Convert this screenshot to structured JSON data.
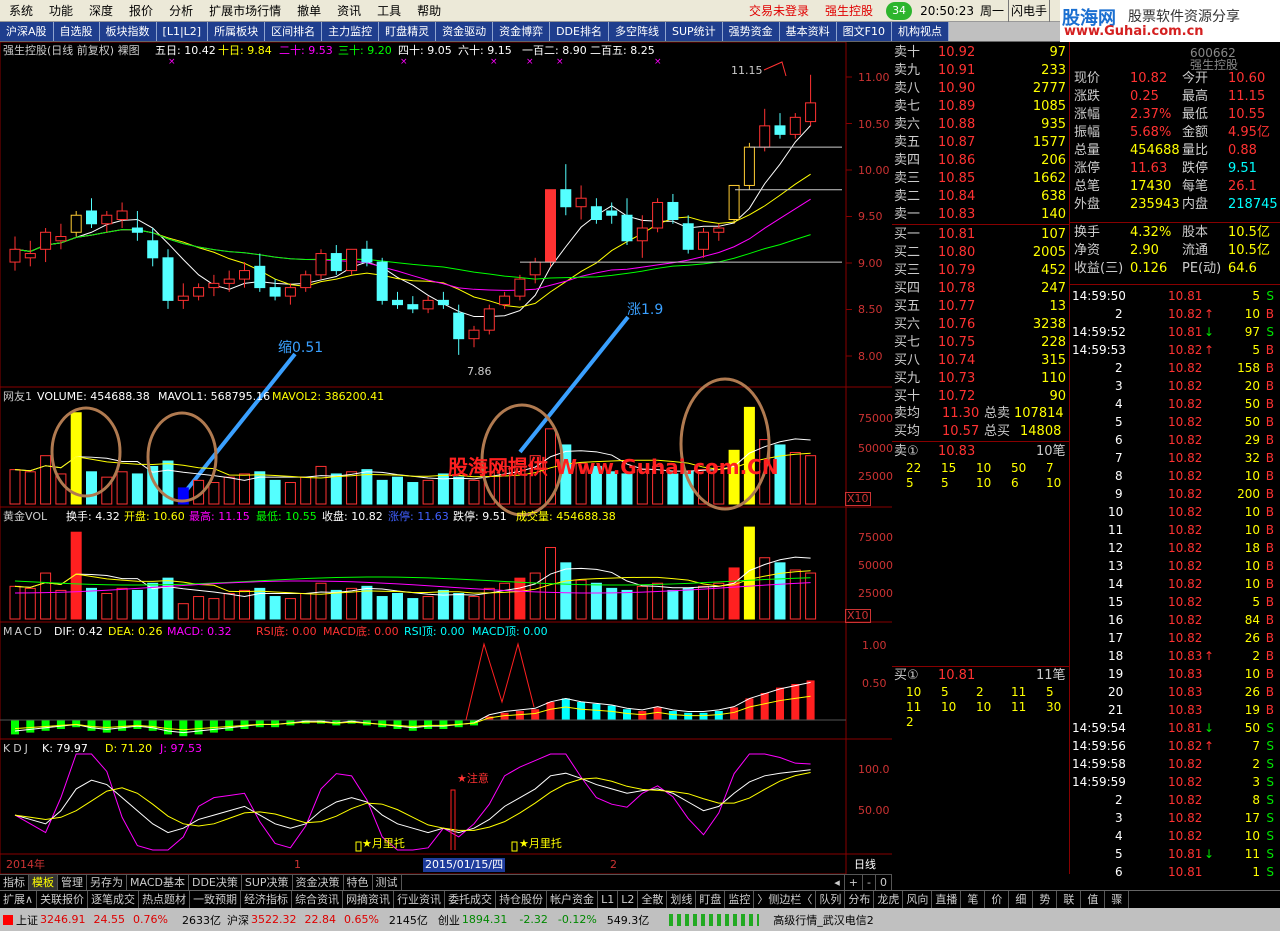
{
  "menubar": {
    "items": [
      "系统",
      "功能",
      "深度",
      "报价",
      "分析",
      "扩展市场行情",
      "撤单",
      "资讯",
      "工具",
      "帮助"
    ],
    "trade_status": "交易未登录",
    "stock_name": "强生控股",
    "badge": "34",
    "time": "20:50:23",
    "weekday": "周一",
    "flash": "闪电手"
  },
  "toolbar": {
    "items": [
      "沪深A股",
      "自选股",
      "板块指数",
      "[L1|L2]",
      "所属板块",
      "区间排名",
      "主力监控",
      "盯盘精灵",
      "资金驱动",
      "资金博弈",
      "DDE排名",
      "多空阵线",
      "SUP统计",
      "强势资金",
      "基本资料",
      "图文F10",
      "机构视点"
    ]
  },
  "logo": {
    "site": "股海网",
    "slogan": "股票软件资源分享",
    "url": "www.Guhai.com.cn"
  },
  "chart_header": {
    "title": "强生控股(日线 前复权) 裸图",
    "ma5": "五日: 10.42",
    "ma10": "十日: 9.84",
    "ma20": "二十: 9.53",
    "ma30": "三十: 9.20",
    "ma40": "四十: 9.05",
    "ma60": "六十: 9.15",
    "ma120": "一百二: 8.90",
    "ma250": "二百五: 8.25"
  },
  "price_axis": [
    "11.00",
    "10.50",
    "10.00",
    "9.50",
    "9.00",
    "8.50",
    "8.00"
  ],
  "annotations": {
    "shrink": "缩0.51",
    "rise": "涨1.9",
    "high_label": "11.15",
    "low_label": "7.86",
    "notice": "★注意",
    "moon1": "★月里托",
    "moon2": "★月里托",
    "watermark": "股海网提供 Www.Guhai.com.CN"
  },
  "vol_header": {
    "name": "网友1",
    "volume": "VOLUME: 454688.38",
    "mavol1": "MAVOL1: 568795.16",
    "mavol2": "MAVOL2: 386200.41"
  },
  "vol_axis": [
    "75000",
    "50000",
    "25000"
  ],
  "vol_multiplier": "X10",
  "vol2_header": {
    "name": "黄金VOL",
    "turnover": "换手: 4.32",
    "open": "开盘: 10.60",
    "high": "最高: 11.15",
    "low": "最低: 10.55",
    "close": "收盘: 10.82",
    "limitup": "涨停: 11.63",
    "limitdown": "跌停: 9.51",
    "volume": "成交量: 454688.38"
  },
  "vol2_axis": [
    "75000",
    "50000",
    "25000"
  ],
  "macd_header": {
    "name": "MACD",
    "dif": "DIF: 0.42",
    "dea": "DEA: 0.26",
    "macd": "MACD: 0.32",
    "rsibottom": "RSI底: 0.00",
    "macdbottom": "MACD底: 0.00",
    "rsitop": "RSI顶: 0.00",
    "macdtop": "MACD顶: 0.00"
  },
  "macd_axis": [
    "1.00",
    "0.50"
  ],
  "kdj_header": {
    "name": "KDJ",
    "k": "K: 79.97",
    "d": "D: 71.20",
    "j": "J: 97.53"
  },
  "kdj_axis": [
    "100.0",
    "50.00"
  ],
  "time_axis": {
    "year": "2014年",
    "m1": "1",
    "selected_date": "2015/01/15/四",
    "m2": "2",
    "period": "日线"
  },
  "chart_data": {
    "type": "candlestick",
    "ohlc": [
      [
        8.95,
        9.25,
        8.85,
        9.1
      ],
      [
        9.0,
        9.2,
        8.9,
        9.05
      ],
      [
        9.1,
        9.35,
        8.95,
        9.3
      ],
      [
        9.2,
        9.4,
        9.1,
        9.25
      ],
      [
        9.3,
        9.55,
        9.25,
        9.5
      ],
      [
        9.55,
        9.7,
        9.35,
        9.4
      ],
      [
        9.4,
        9.55,
        9.3,
        9.5
      ],
      [
        9.45,
        9.65,
        9.35,
        9.55
      ],
      [
        9.35,
        9.55,
        9.2,
        9.3
      ],
      [
        9.2,
        9.35,
        8.9,
        9.0
      ],
      [
        9.0,
        9.1,
        8.4,
        8.5
      ],
      [
        8.5,
        8.7,
        8.4,
        8.55
      ],
      [
        8.55,
        8.7,
        8.5,
        8.65
      ],
      [
        8.65,
        8.8,
        8.55,
        8.7
      ],
      [
        8.7,
        8.85,
        8.6,
        8.75
      ],
      [
        8.75,
        8.95,
        8.65,
        8.85
      ],
      [
        8.9,
        9.05,
        8.6,
        8.65
      ],
      [
        8.65,
        8.75,
        8.5,
        8.55
      ],
      [
        8.55,
        8.7,
        8.45,
        8.65
      ],
      [
        8.65,
        8.85,
        8.6,
        8.8
      ],
      [
        8.8,
        9.1,
        8.75,
        9.05
      ],
      [
        9.05,
        9.15,
        8.8,
        8.85
      ],
      [
        8.85,
        9.1,
        8.8,
        9.1
      ],
      [
        9.1,
        9.2,
        8.9,
        8.95
      ],
      [
        8.95,
        9.0,
        8.45,
        8.5
      ],
      [
        8.5,
        8.6,
        8.4,
        8.45
      ],
      [
        8.45,
        8.55,
        8.35,
        8.4
      ],
      [
        8.4,
        8.55,
        8.35,
        8.5
      ],
      [
        8.5,
        8.6,
        8.4,
        8.45
      ],
      [
        8.35,
        8.45,
        7.86,
        8.05
      ],
      [
        8.05,
        8.2,
        7.95,
        8.15
      ],
      [
        8.15,
        8.45,
        8.1,
        8.4
      ],
      [
        8.45,
        8.6,
        8.4,
        8.55
      ],
      [
        8.55,
        8.8,
        8.5,
        8.75
      ],
      [
        8.8,
        9.0,
        8.7,
        8.95
      ],
      [
        8.95,
        9.8,
        8.9,
        9.8
      ],
      [
        9.8,
        10.1,
        9.5,
        9.6
      ],
      [
        9.6,
        9.85,
        9.45,
        9.7
      ],
      [
        9.6,
        9.7,
        9.4,
        9.45
      ],
      [
        9.55,
        9.65,
        9.4,
        9.5
      ],
      [
        9.5,
        9.7,
        9.15,
        9.2
      ],
      [
        9.2,
        9.5,
        9.0,
        9.35
      ],
      [
        9.35,
        9.7,
        9.3,
        9.65
      ],
      [
        9.65,
        9.75,
        9.4,
        9.45
      ],
      [
        9.4,
        9.5,
        9.05,
        9.1
      ],
      [
        9.1,
        9.35,
        9.0,
        9.3
      ],
      [
        9.3,
        9.4,
        9.2,
        9.35
      ],
      [
        9.45,
        9.85,
        9.4,
        9.85
      ],
      [
        9.85,
        10.35,
        9.8,
        10.3
      ],
      [
        10.3,
        10.75,
        10.25,
        10.55
      ],
      [
        10.55,
        10.7,
        10.4,
        10.45
      ],
      [
        10.45,
        10.7,
        10.4,
        10.65
      ],
      [
        10.6,
        11.15,
        10.55,
        10.82
      ]
    ],
    "volume": [
      32,
      30,
      45,
      28,
      85,
      30,
      25,
      30,
      28,
      35,
      40,
      15,
      22,
      20,
      25,
      28,
      30,
      22,
      20,
      25,
      35,
      28,
      30,
      32,
      22,
      25,
      20,
      22,
      28,
      25,
      22,
      30,
      35,
      40,
      45,
      70,
      55,
      38,
      35,
      30,
      28,
      32,
      35,
      28,
      30,
      32,
      35,
      50,
      90,
      60,
      55,
      48,
      45
    ],
    "macd_hist": [
      -0.08,
      -0.07,
      -0.06,
      -0.05,
      -0.04,
      -0.06,
      -0.07,
      -0.06,
      -0.05,
      -0.06,
      -0.08,
      -0.09,
      -0.08,
      -0.07,
      -0.06,
      -0.05,
      -0.04,
      -0.04,
      -0.03,
      -0.02,
      -0.02,
      -0.03,
      -0.02,
      -0.03,
      -0.04,
      -0.05,
      -0.06,
      -0.05,
      -0.05,
      -0.04,
      -0.03,
      0.02,
      0.04,
      0.05,
      0.06,
      0.1,
      0.12,
      0.1,
      0.09,
      0.08,
      0.06,
      0.05,
      0.07,
      0.05,
      0.04,
      0.04,
      0.05,
      0.07,
      0.12,
      0.15,
      0.18,
      0.2,
      0.22
    ],
    "kdj_k": [
      40,
      35,
      30,
      45,
      70,
      80,
      75,
      60,
      45,
      30,
      20,
      25,
      35,
      40,
      45,
      50,
      40,
      30,
      25,
      30,
      45,
      55,
      60,
      55,
      40,
      30,
      25,
      20,
      25,
      20,
      25,
      35,
      50,
      60,
      70,
      85,
      88,
      82,
      75,
      70,
      65,
      68,
      70,
      65,
      55,
      45,
      50,
      65,
      78,
      85,
      88,
      90,
      92
    ]
  },
  "quote": {
    "code": "600662",
    "name": "强生控股",
    "sell_levels": [
      {
        "label": "卖十",
        "price": "10.92",
        "vol": "97"
      },
      {
        "label": "卖九",
        "price": "10.91",
        "vol": "233"
      },
      {
        "label": "卖八",
        "price": "10.90",
        "vol": "2777"
      },
      {
        "label": "卖七",
        "price": "10.89",
        "vol": "1085"
      },
      {
        "label": "卖六",
        "price": "10.88",
        "vol": "935"
      },
      {
        "label": "卖五",
        "price": "10.87",
        "vol": "1577"
      },
      {
        "label": "卖四",
        "price": "10.86",
        "vol": "206"
      },
      {
        "label": "卖三",
        "price": "10.85",
        "vol": "1662"
      },
      {
        "label": "卖二",
        "price": "10.84",
        "vol": "638"
      },
      {
        "label": "卖一",
        "price": "10.83",
        "vol": "140"
      }
    ],
    "buy_levels": [
      {
        "label": "买一",
        "price": "10.81",
        "vol": "107"
      },
      {
        "label": "买二",
        "price": "10.80",
        "vol": "2005"
      },
      {
        "label": "买三",
        "price": "10.79",
        "vol": "452"
      },
      {
        "label": "买四",
        "price": "10.78",
        "vol": "247"
      },
      {
        "label": "买五",
        "price": "10.77",
        "vol": "13"
      },
      {
        "label": "买六",
        "price": "10.76",
        "vol": "3238"
      },
      {
        "label": "买七",
        "price": "10.75",
        "vol": "228"
      },
      {
        "label": "买八",
        "price": "10.74",
        "vol": "315"
      },
      {
        "label": "买九",
        "price": "10.73",
        "vol": "110"
      },
      {
        "label": "买十",
        "price": "10.72",
        "vol": "90"
      }
    ],
    "avg_sell_label": "卖均",
    "avg_sell": "11.30",
    "total_sell_label": "总卖",
    "total_sell": "107814",
    "avg_buy_label": "买均",
    "avg_buy": "10.57",
    "total_buy_label": "总买",
    "total_buy": "14808",
    "sell1_queue_label": "卖①",
    "sell1_queue_price": "10.83",
    "sell1_queue_count": "10笔",
    "sell1_queue": [
      "22",
      "15",
      "10",
      "50",
      "7",
      "5",
      "5",
      "10",
      "6",
      "10"
    ],
    "buy1_queue_label": "买①",
    "buy1_queue_price": "10.81",
    "buy1_queue_count": "11笔",
    "buy1_queue": [
      "10",
      "5",
      "2",
      "11",
      "5",
      "11",
      "10",
      "10",
      "11",
      "30",
      "2"
    ],
    "stats": [
      {
        "l": "现价",
        "v": "10.82",
        "l2": "今开",
        "v2": "10.60"
      },
      {
        "l": "涨跌",
        "v": "0.25",
        "l2": "最高",
        "v2": "11.15"
      },
      {
        "l": "涨幅",
        "v": "2.37%",
        "l2": "最低",
        "v2": "10.55"
      },
      {
        "l": "振幅",
        "v": "5.68%",
        "l2": "金额",
        "v2": "4.95亿"
      },
      {
        "l": "总量",
        "v": "454688",
        "l2": "量比",
        "v2": "0.88"
      },
      {
        "l": "涨停",
        "v": "11.63",
        "l2": "跌停",
        "v2": "9.51"
      },
      {
        "l": "总笔",
        "v": "17430",
        "l2": "每笔",
        "v2": "26.1"
      },
      {
        "l": "外盘",
        "v": "235943",
        "l2": "内盘",
        "v2": "218745"
      }
    ],
    "stats2": [
      {
        "l": "换手",
        "v": "4.32%",
        "l2": "股本",
        "v2": "10.5亿"
      },
      {
        "l": "净资",
        "v": "2.90",
        "l2": "流通",
        "v2": "10.5亿"
      },
      {
        "l": "收益(三)",
        "v": "0.126",
        "l2": "PE(动)",
        "v2": "64.6"
      }
    ]
  },
  "ticks": [
    {
      "t": "14:59:50",
      "p": "10.81",
      "a": "",
      "v": "5",
      "s": "S"
    },
    {
      "t": "2",
      "p": "10.82",
      "a": "↑",
      "v": "10",
      "s": "B"
    },
    {
      "t": "14:59:52",
      "p": "10.81",
      "a": "↓",
      "v": "97",
      "s": "S"
    },
    {
      "t": "14:59:53",
      "p": "10.82",
      "a": "↑",
      "v": "5",
      "s": "B"
    },
    {
      "t": "2",
      "p": "10.82",
      "a": "",
      "v": "158",
      "s": "B"
    },
    {
      "t": "3",
      "p": "10.82",
      "a": "",
      "v": "20",
      "s": "B"
    },
    {
      "t": "4",
      "p": "10.82",
      "a": "",
      "v": "50",
      "s": "B"
    },
    {
      "t": "5",
      "p": "10.82",
      "a": "",
      "v": "50",
      "s": "B"
    },
    {
      "t": "6",
      "p": "10.82",
      "a": "",
      "v": "29",
      "s": "B"
    },
    {
      "t": "7",
      "p": "10.82",
      "a": "",
      "v": "32",
      "s": "B"
    },
    {
      "t": "8",
      "p": "10.82",
      "a": "",
      "v": "10",
      "s": "B"
    },
    {
      "t": "9",
      "p": "10.82",
      "a": "",
      "v": "200",
      "s": "B"
    },
    {
      "t": "10",
      "p": "10.82",
      "a": "",
      "v": "10",
      "s": "B"
    },
    {
      "t": "11",
      "p": "10.82",
      "a": "",
      "v": "10",
      "s": "B"
    },
    {
      "t": "12",
      "p": "10.82",
      "a": "",
      "v": "18",
      "s": "B"
    },
    {
      "t": "13",
      "p": "10.82",
      "a": "",
      "v": "10",
      "s": "B"
    },
    {
      "t": "14",
      "p": "10.82",
      "a": "",
      "v": "10",
      "s": "B"
    },
    {
      "t": "15",
      "p": "10.82",
      "a": "",
      "v": "5",
      "s": "B"
    },
    {
      "t": "16",
      "p": "10.82",
      "a": "",
      "v": "84",
      "s": "B"
    },
    {
      "t": "17",
      "p": "10.82",
      "a": "",
      "v": "26",
      "s": "B"
    },
    {
      "t": "18",
      "p": "10.83",
      "a": "↑",
      "v": "2",
      "s": "B"
    },
    {
      "t": "19",
      "p": "10.83",
      "a": "",
      "v": "10",
      "s": "B"
    },
    {
      "t": "20",
      "p": "10.83",
      "a": "",
      "v": "26",
      "s": "B"
    },
    {
      "t": "21",
      "p": "10.83",
      "a": "",
      "v": "19",
      "s": "B"
    },
    {
      "t": "14:59:54",
      "p": "10.81",
      "a": "↓",
      "v": "50",
      "s": "S"
    },
    {
      "t": "14:59:56",
      "p": "10.82",
      "a": "↑",
      "v": "7",
      "s": "S"
    },
    {
      "t": "14:59:58",
      "p": "10.82",
      "a": "",
      "v": "2",
      "s": "S"
    },
    {
      "t": "14:59:59",
      "p": "10.82",
      "a": "",
      "v": "3",
      "s": "S"
    },
    {
      "t": "2",
      "p": "10.82",
      "a": "",
      "v": "8",
      "s": "S"
    },
    {
      "t": "3",
      "p": "10.82",
      "a": "",
      "v": "17",
      "s": "S"
    },
    {
      "t": "4",
      "p": "10.82",
      "a": "",
      "v": "10",
      "s": "S"
    },
    {
      "t": "5",
      "p": "10.81",
      "a": "↓",
      "v": "11",
      "s": "S"
    },
    {
      "t": "6",
      "p": "10.81",
      "a": "",
      "v": "1",
      "s": "S"
    }
  ],
  "tabs1": [
    "指标",
    "模板",
    "管理",
    "另存为",
    "MACD基本",
    "DDE决策",
    "SUP决策",
    "资金决策",
    "特色",
    "测试"
  ],
  "tabs1_nav": [
    "◂",
    "+",
    "-",
    "0"
  ],
  "tabs2": [
    "扩展∧",
    "关联报价",
    "逐笔成交",
    "热点题材",
    "一致预期",
    "经济指标",
    "综合资讯",
    "网摘资讯",
    "行业资讯",
    "委托成交",
    "持仓股份",
    "帐户资金",
    "L1",
    "L2",
    "全散",
    "划线",
    "盯盘",
    "监控",
    "〉侧边栏〈",
    "队列",
    "分布",
    "龙虎",
    "风向",
    "直播",
    "笔",
    "价",
    "细",
    "势",
    "联",
    "值",
    "骤"
  ],
  "status": {
    "sh_label": "上证",
    "sh": "3246.91",
    "sh_chg": "24.55",
    "sh_pct": "0.76%",
    "sh_amt": "2633亿",
    "hs_label": "沪深",
    "hs": "3522.32",
    "hs_chg": "22.84",
    "hs_pct": "0.65%",
    "hs_amt": "2145亿",
    "cy_label": "创业",
    "cy": "1894.31",
    "cy_chg": "-2.32",
    "cy_pct": "-0.12%",
    "cy_amt": "549.3亿",
    "level": "高级行情_武汉电信2"
  }
}
